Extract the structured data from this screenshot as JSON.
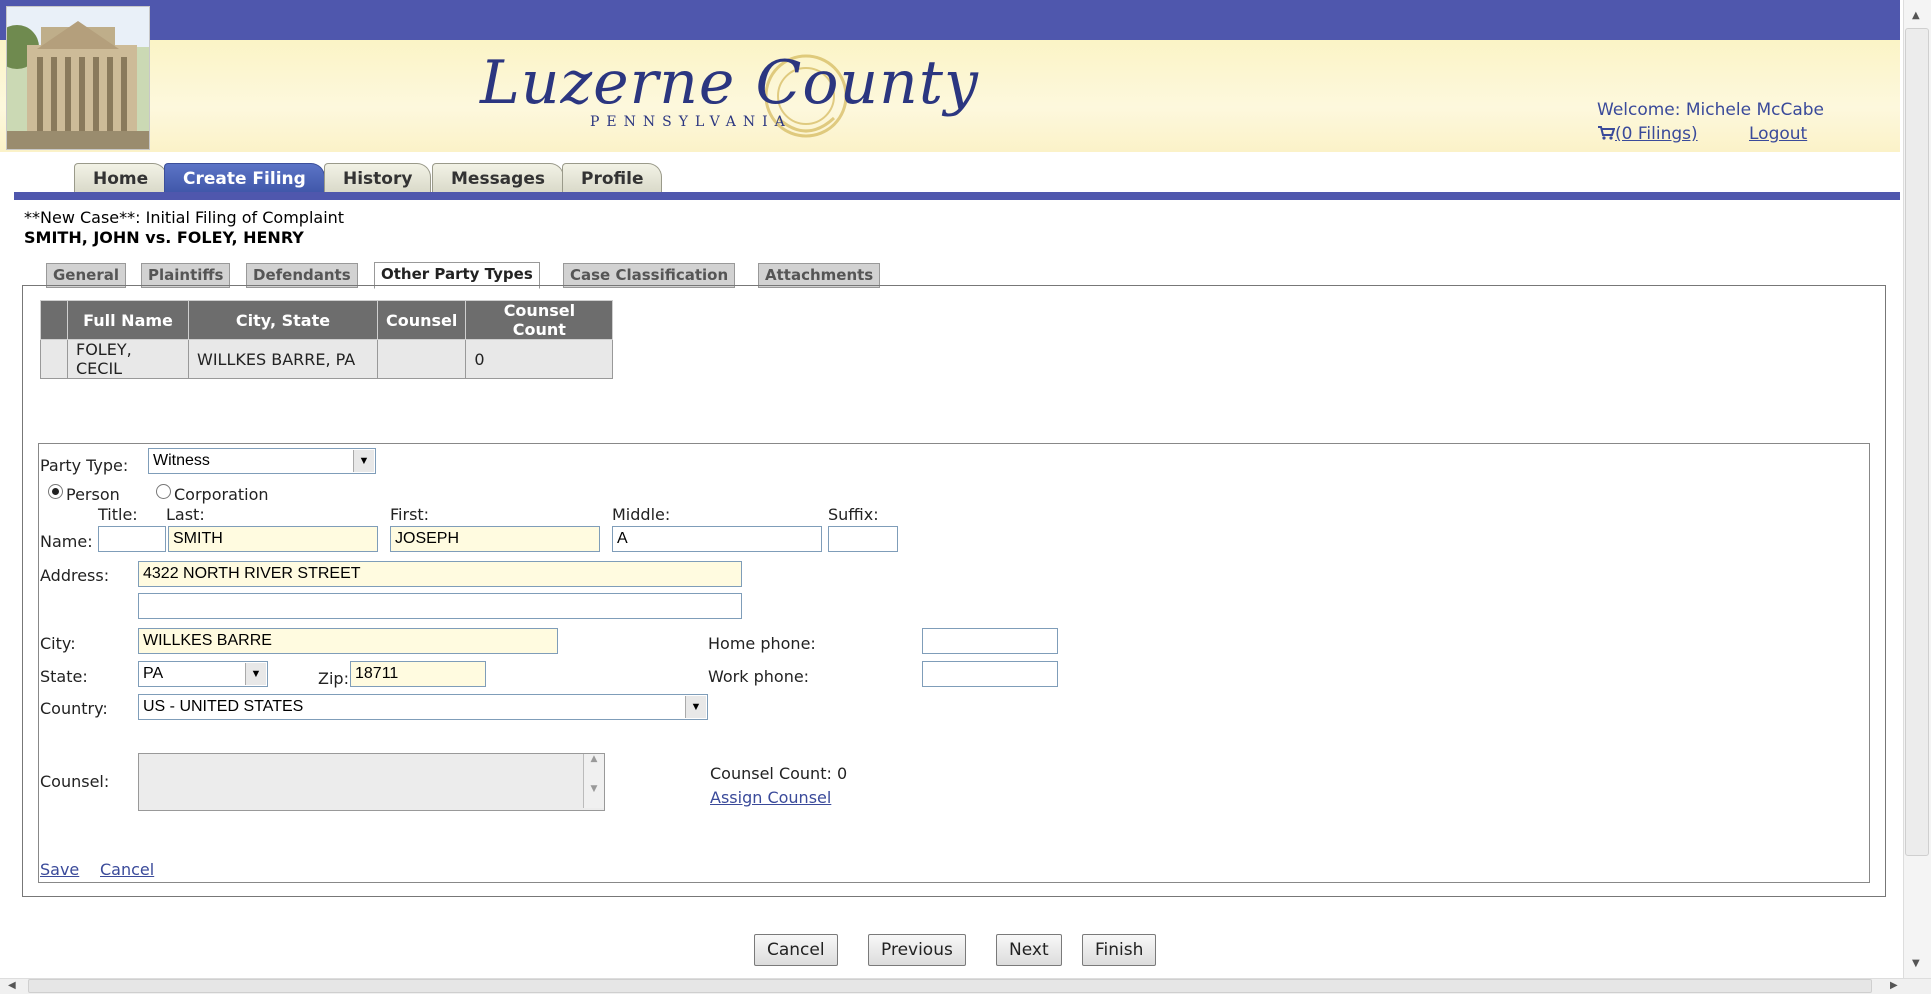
{
  "header": {
    "logo_text": "Luzerne County",
    "logo_subtext": "PENNSYLVANIA",
    "welcome": "Welcome: Michele McCabe",
    "cart": "(0 Filings)",
    "logout": "Logout"
  },
  "nav": {
    "tabs": [
      {
        "label": "Home"
      },
      {
        "label": "Create Filing"
      },
      {
        "label": "History"
      },
      {
        "label": "Messages"
      },
      {
        "label": "Profile"
      }
    ],
    "active": "Create Filing"
  },
  "case": {
    "title": "**New Case**: Initial Filing of Complaint",
    "parties": "SMITH, JOHN vs. FOLEY, HENRY"
  },
  "subtabs": {
    "items": [
      {
        "label": "General"
      },
      {
        "label": "Plaintiffs"
      },
      {
        "label": "Defendants"
      },
      {
        "label": "Other Party Types"
      },
      {
        "label": "Case Classification"
      },
      {
        "label": "Attachments"
      }
    ],
    "active": "Other Party Types"
  },
  "party_table": {
    "headers": [
      "Full Name",
      "City, State",
      "Counsel",
      "Counsel Count"
    ],
    "rows": [
      [
        "FOLEY, CECIL",
        "WILLKES BARRE, PA",
        "",
        "0"
      ]
    ]
  },
  "form": {
    "party_type_label": "Party Type:",
    "party_type_value": "Witness",
    "person_label": "Person",
    "corporation_label": "Corporation",
    "title_label": "Title:",
    "last_label": "Last:",
    "first_label": "First:",
    "middle_label": "Middle:",
    "suffix_label": "Suffix:",
    "name_label": "Name:",
    "title_value": "",
    "last_value": "SMITH",
    "first_value": "JOSEPH",
    "middle_value": "A",
    "suffix_value": "",
    "address_label": "Address:",
    "address1": "4322 NORTH RIVER STREET",
    "address2": "",
    "city_label": "City:",
    "city_value": "WILLKES BARRE",
    "state_label": "State:",
    "state_value": "PA",
    "zip_label": "Zip:",
    "zip_value": "18711",
    "country_label": "Country:",
    "country_value": "US - UNITED STATES",
    "home_phone_label": "Home phone:",
    "home_phone_value": "",
    "work_phone_label": "Work phone:",
    "work_phone_value": "",
    "counsel_label": "Counsel:",
    "counsel_count": "Counsel Count: 0",
    "assign_counsel": "Assign Counsel",
    "save": "Save",
    "cancel": "Cancel"
  },
  "buttons": {
    "cancel": "Cancel",
    "previous": "Previous",
    "next": "Next",
    "finish": "Finish"
  },
  "colors": {
    "accent_blue": "#4f57ad",
    "banner_yellow": "#fbf4c6",
    "field_highlight": "#fffbe0",
    "link": "#3a4a9a"
  },
  "icons": {
    "cart": "shopping-cart-icon",
    "dropdown": "chevron-down-icon"
  }
}
